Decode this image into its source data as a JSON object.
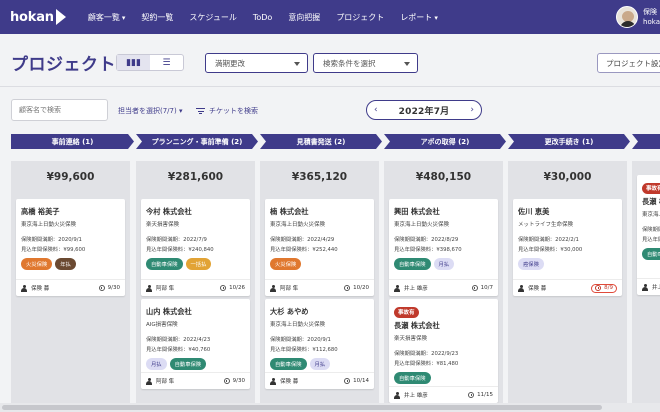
{
  "nav": {
    "logo": "hokan",
    "items": [
      {
        "label": "顧客一覧",
        "caret": "▾"
      },
      {
        "label": "契約一覧"
      },
      {
        "label": "スケジュール"
      },
      {
        "label": "ToDo"
      },
      {
        "label": "意向把握"
      },
      {
        "label": "プロジェクト"
      },
      {
        "label": "レポート",
        "caret": "▾"
      }
    ],
    "user_line1": "保険",
    "user_line2": "hoka"
  },
  "page": {
    "title": "プロジェクト",
    "view_kanban_icon": "▮▮▮",
    "view_list_icon": "☰",
    "select_renewal": "満期更改",
    "select_conditions": "検索条件を選択",
    "settings_button": "プロジェクト設定"
  },
  "filters": {
    "search_placeholder": "顧客名で検索",
    "assignee": "担当者を選択(7/7) ▾",
    "ticket_search": "チケットを検索",
    "month_prev": "‹",
    "month_label": "2022年7月",
    "month_next": "›"
  },
  "colors": {
    "brand": "#3f3b8a",
    "stage": "#3f3b8a",
    "badge_fire": "#e0782f",
    "badge_annual": "#6b4a32",
    "badge_auto": "#2f8a73",
    "badge_lump": "#e2a335",
    "badge_monthly": "#dcdcf4",
    "badge_cancer": "#dcdcf4",
    "tag_deal": "#c0392b"
  },
  "stages": [
    {
      "label": "事前連絡 (1)"
    },
    {
      "label": "プランニング・事前準備 (2)"
    },
    {
      "label": "見積書発送 (2)"
    },
    {
      "label": "アポの取得 (2)"
    },
    {
      "label": "更改手続き (1)"
    },
    {
      "label": ""
    }
  ],
  "columns": [
    {
      "total": "¥99,600",
      "cards": [
        {
          "tag": "",
          "name": "高橋 裕美子",
          "company": "東京海上日動火災保険",
          "expiry": "保険期間満期：2020/9/1",
          "premium": "見込年間保険料：¥99,600",
          "badges": [
            {
              "text": "火災保険",
              "kind": "fire"
            },
            {
              "text": "年払",
              "kind": "annual"
            }
          ],
          "assignee": "保険 募",
          "due": "9/30",
          "overdue": false
        }
      ]
    },
    {
      "total": "¥281,600",
      "cards": [
        {
          "tag": "",
          "name": "今村 株式会社",
          "company": "楽天損害保険",
          "expiry": "保険期間満期：2022/7/9",
          "premium": "見込年間保険料：¥240,840",
          "badges": [
            {
              "text": "自動車保険",
              "kind": "auto"
            },
            {
              "text": "一括払",
              "kind": "lump"
            }
          ],
          "assignee": "阿部 隼",
          "due": "10/26",
          "overdue": false
        },
        {
          "tag": "",
          "name": "山内 株式会社",
          "company": "AIG損害保険",
          "expiry": "保険期間満期：2022/4/23",
          "premium": "見込年間保険料：¥40,760",
          "badges": [
            {
              "text": "月払",
              "kind": "monthly"
            },
            {
              "text": "自動車保険",
              "kind": "auto"
            }
          ],
          "assignee": "阿部 隼",
          "due": "9/30",
          "overdue": false
        }
      ]
    },
    {
      "total": "¥365,120",
      "cards": [
        {
          "tag": "",
          "name": "楠 株式会社",
          "company": "東京海上日動火災保険",
          "expiry": "保険期間満期：2022/4/29",
          "premium": "見込年間保険料：¥252,440",
          "badges": [
            {
              "text": "火災保険",
              "kind": "fire"
            }
          ],
          "assignee": "阿部 隼",
          "due": "10/20",
          "overdue": false
        },
        {
          "tag": "",
          "name": "大杉 あやめ",
          "company": "東京海上日動火災保険",
          "expiry": "保険期間満期：2020/9/1",
          "premium": "見込年間保険料：¥112,680",
          "badges": [
            {
              "text": "自動車保険",
              "kind": "auto"
            },
            {
              "text": "月払",
              "kind": "monthly"
            }
          ],
          "assignee": "保険 募",
          "due": "10/14",
          "overdue": false
        }
      ]
    },
    {
      "total": "¥480,150",
      "cards": [
        {
          "tag": "",
          "name": "興田 株式会社",
          "company": "東京海上日動火災保険",
          "expiry": "保険期間満期：2022/8/29",
          "premium": "見込年間保険料：¥398,670",
          "badges": [
            {
              "text": "自動車保険",
              "kind": "auto"
            },
            {
              "text": "月払",
              "kind": "monthly"
            }
          ],
          "assignee": "井上 雄彦",
          "due": "10/7",
          "overdue": false
        },
        {
          "tag": "事故有",
          "name": "長瀬 株式会社",
          "company": "楽天損害保険",
          "expiry": "保険期間満期：2022/9/23",
          "premium": "見込年間保険料：¥81,480",
          "badges": [
            {
              "text": "自動車保険",
              "kind": "auto"
            }
          ],
          "assignee": "井上 雄彦",
          "due": "11/15",
          "overdue": false
        }
      ]
    },
    {
      "total": "¥30,000",
      "cards": [
        {
          "tag": "",
          "name": "佐川 恵美",
          "company": "メットライフ生命保険",
          "expiry": "保険期間満期：2022/2/1",
          "premium": "見込年間保険料：¥30,000",
          "badges": [
            {
              "text": "癌保険",
              "kind": "cancer"
            }
          ],
          "assignee": "保険 募",
          "due": "8/9",
          "overdue": true
        }
      ]
    },
    {
      "total": "",
      "cards": [
        {
          "tag": "事故有",
          "name": "長瀬 株",
          "company": "東京海上",
          "expiry": "保険期間満",
          "premium": "見込年間保",
          "badges": [
            {
              "text": "自動車",
              "kind": "auto"
            }
          ],
          "assignee": "井上",
          "due": "",
          "overdue": false
        }
      ]
    }
  ]
}
